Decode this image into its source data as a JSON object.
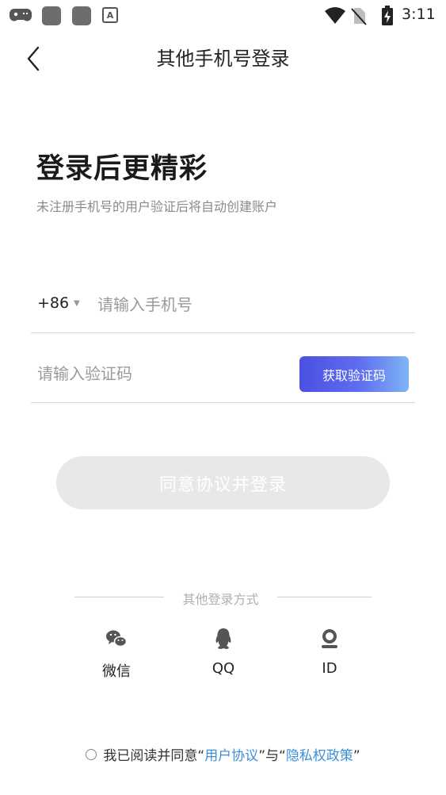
{
  "status_bar": {
    "time": "3:11",
    "icons": [
      "gamepad-icon",
      "notification-square-icon",
      "notification-square-icon",
      "a-icon",
      "wifi-icon",
      "no-sim-icon",
      "battery-charging-icon"
    ],
    "a_letter": "A"
  },
  "header": {
    "title": "其他手机号登录",
    "back_icon": "chevron-left-icon"
  },
  "hero": {
    "title": "登录后更精彩",
    "subtitle": "未注册手机号的用户验证后将自动创建账户"
  },
  "phone": {
    "country_code": "+86",
    "dropdown_arrow": "▼",
    "placeholder": "请输入手机号",
    "value": ""
  },
  "code": {
    "placeholder": "请输入验证码",
    "value": "",
    "get_code_label": "获取验证码"
  },
  "login_button": {
    "label": "同意协议并登录"
  },
  "other_login": {
    "label": "其他登录方式",
    "options": [
      {
        "label": "微信",
        "icon": "wechat-icon"
      },
      {
        "label": "QQ",
        "icon": "qq-icon"
      },
      {
        "label": "ID",
        "icon": "id-icon"
      }
    ]
  },
  "agreement": {
    "prefix": "我已阅读并同意",
    "q1_open": "“",
    "user_agreement": "用户协议",
    "q1_close": "”",
    "and": "与",
    "q2_open": "“",
    "privacy_policy": "隐私权政策",
    "q2_close": "”"
  },
  "colors": {
    "accent_gradient_start": "#4b50e0",
    "accent_gradient_end": "#7fb5f5",
    "link": "#3b8fd8",
    "disabled_button": "#e8e8e8"
  }
}
